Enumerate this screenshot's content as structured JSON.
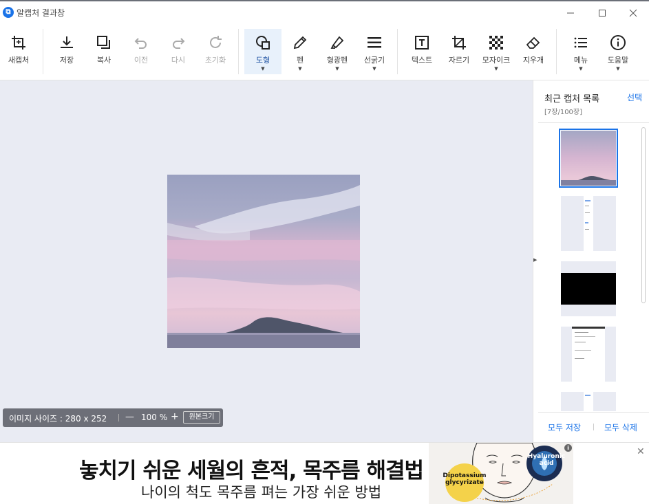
{
  "window": {
    "title": "알캡처 결과창",
    "app_icon_glyph": "⧉",
    "minimize_glyph": "—",
    "maximize_glyph": "☐",
    "close_glyph": "✕"
  },
  "toolbar": {
    "new_capture": "새캡처",
    "save": "저장",
    "copy": "복사",
    "undo": "이전",
    "redo": "다시",
    "reset": "초기화",
    "shape": "도형",
    "pen": "펜",
    "highlighter": "형광펜",
    "line_width": "선굵기",
    "text": "텍스트",
    "crop": "자르기",
    "mosaic": "모자이크",
    "eraser": "지우개",
    "menu": "메뉴",
    "help": "도움말",
    "caret": "▼"
  },
  "status": {
    "image_size": "이미지 사이즈 : 280 x 252",
    "zoom_out": "—",
    "zoom": "100 %",
    "zoom_in": "+",
    "original_size": "원본크기"
  },
  "splitter": {
    "arrow": "▶"
  },
  "side_panel": {
    "title": "최근 캡처 목록",
    "count": "[7장/100장]",
    "select": "선택",
    "save_all": "모두 저장",
    "delete_all": "모두 삭제"
  },
  "ad": {
    "headline": "놓치기 쉬운 세월의 흔적, 목주름 해결법",
    "subline": "나이의 척도 목주름 펴는 가장 쉬운 방법",
    "badge_left": "Dipotassium glycyrizate",
    "badge_right": "Hyaluronic acid",
    "info": "i",
    "close": "✕"
  },
  "colors": {
    "accent": "#1a73e8",
    "canvas_bg": "#e9ebf3",
    "status_bg": "#6d6f78"
  }
}
